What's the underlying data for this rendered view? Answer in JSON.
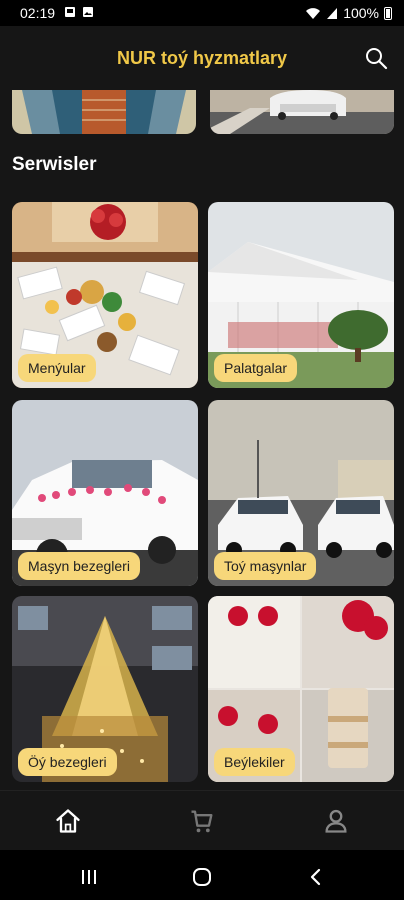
{
  "status": {
    "time": "02:19",
    "battery": "100%"
  },
  "app": {
    "title": "NUR toý hyzmatlary"
  },
  "section": {
    "title": "Serwisler"
  },
  "services": [
    {
      "label": "Menýular"
    },
    {
      "label": "Palatgalar"
    },
    {
      "label": "Maşyn bezegleri"
    },
    {
      "label": "Toý maşynlar"
    },
    {
      "label": "Öý bezegleri"
    },
    {
      "label": "Beýlekiler"
    }
  ],
  "bottom_nav": {
    "active": "home",
    "items": [
      "home-icon",
      "cart-icon",
      "profile-icon"
    ]
  }
}
